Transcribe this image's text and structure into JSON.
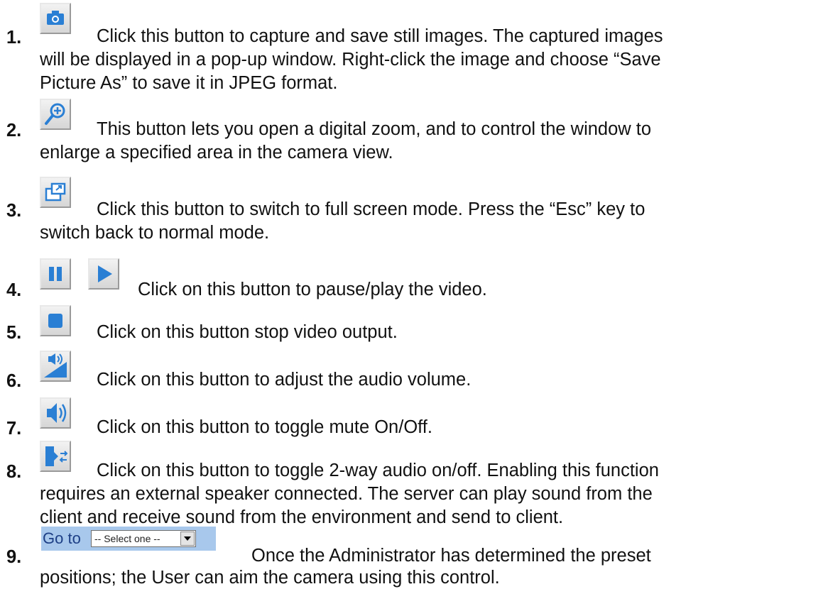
{
  "items": [
    {
      "number": "1.",
      "icon": "camera-icon",
      "lines": [
        "Click this button to capture and save still images. The captured images",
        "will be displayed in a pop-up window. Right-click the image and choose “Save",
        "Picture As” to save it in JPEG format."
      ]
    },
    {
      "number": "2.",
      "icon": "zoom-in-icon",
      "lines": [
        "This button lets you open a digital zoom, and to control the window to",
        "enlarge a specified area in the camera view."
      ]
    },
    {
      "number": "3.",
      "icon": "fullscreen-icon",
      "lines": [
        "Click this button to switch to full screen mode. Press the “Esc” key to",
        "switch back to normal mode."
      ]
    },
    {
      "number": "4.",
      "icon": "pause-play-icons",
      "lines": [
        "Click on this button to pause/play the video."
      ]
    },
    {
      "number": "5.",
      "icon": "stop-icon",
      "lines": [
        "Click on this button stop video output."
      ]
    },
    {
      "number": "6.",
      "icon": "volume-icon",
      "lines": [
        "Click on this button to adjust the audio volume."
      ]
    },
    {
      "number": "7.",
      "icon": "mute-icon",
      "lines": [
        "Click on this button to toggle mute On/Off."
      ]
    },
    {
      "number": "8.",
      "icon": "two-way-audio-icon",
      "lines": [
        "Click on this button to toggle 2-way audio on/off. Enabling this function",
        "requires an external speaker connected. The server can play sound from the",
        "client and receive sound from the environment and send to client."
      ]
    },
    {
      "number": "9.",
      "icon": "preset-goto-control",
      "lines": [
        "Once the Administrator has determined the preset",
        "positions; the User can aim the camera using this control."
      ]
    }
  ],
  "goto_control": {
    "label": "Go to",
    "selected": "-- Select one --"
  },
  "colors": {
    "icon_blue": "#2a7fd4",
    "goto_background": "#a8c8ec",
    "goto_text": "#1d3f86"
  }
}
